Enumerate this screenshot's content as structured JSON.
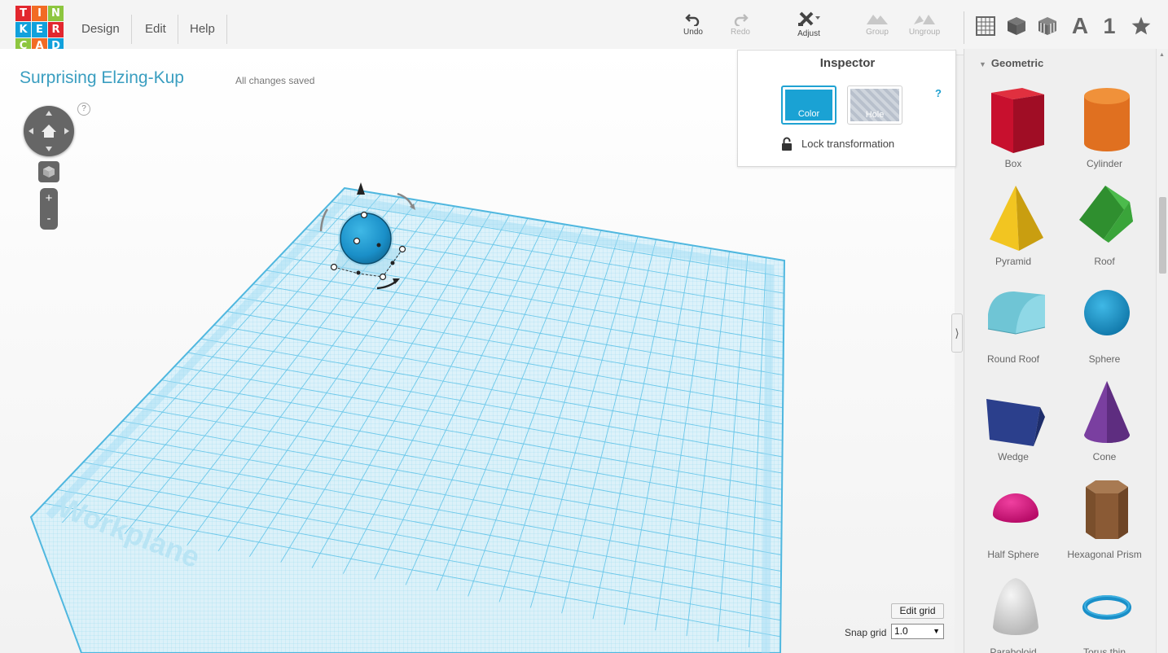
{
  "logo": {
    "letters": [
      "T",
      "I",
      "N",
      "K",
      "E",
      "R",
      "C",
      "A",
      "D"
    ],
    "colors": [
      "#e2272e",
      "#f26b24",
      "#8dc63f",
      "#11a1dc",
      "#11a1dc",
      "#e2272e",
      "#8dc63f",
      "#f26b24",
      "#11a1dc"
    ]
  },
  "menu": {
    "design": "Design",
    "edit": "Edit",
    "help": "Help"
  },
  "toolbar": {
    "undo": "Undo",
    "redo": "Redo",
    "adjust": "Adjust",
    "group": "Group",
    "ungroup": "Ungroup"
  },
  "view_icons": {
    "grid": "grid-icon",
    "cube": "cube-icon",
    "box_stripes": "striped-cube-icon",
    "text": "A",
    "number": "1",
    "star": "star-icon"
  },
  "design": {
    "title": "Surprising Elzing-Kup",
    "save_status": "All changes saved"
  },
  "help_mark": "?",
  "zoom": {
    "in": "+",
    "out": "-"
  },
  "workplane": {
    "label": "Workplane",
    "color": "#5ec5e8"
  },
  "inspector": {
    "title": "Inspector",
    "help": "?",
    "color_label": "Color",
    "hole_label": "Hole",
    "lock_label": "Lock transformation",
    "selected_color": "#1aa2d4"
  },
  "grid": {
    "edit_grid": "Edit grid",
    "snap_label": "Snap grid",
    "snap_value": "1.0"
  },
  "panel": {
    "category": "Geometric",
    "shapes": [
      {
        "label": "Box",
        "icon": "box-shape",
        "color": "#c8102e"
      },
      {
        "label": "Cylinder",
        "icon": "cylinder-shape",
        "color": "#e87722"
      },
      {
        "label": "Pyramid",
        "icon": "pyramid-shape",
        "color": "#f2c521"
      },
      {
        "label": "Roof",
        "icon": "roof-shape",
        "color": "#3aa43a"
      },
      {
        "label": "Round Roof",
        "icon": "round-roof-shape",
        "color": "#6fc5d5"
      },
      {
        "label": "Sphere",
        "icon": "sphere-shape",
        "color": "#1a8fc8"
      },
      {
        "label": "Wedge",
        "icon": "wedge-shape",
        "color": "#2b3f8c"
      },
      {
        "label": "Cone",
        "icon": "cone-shape",
        "color": "#7a3fa0"
      },
      {
        "label": "Half Sphere",
        "icon": "half-sphere-shape",
        "color": "#e0107f"
      },
      {
        "label": "Hexagonal Prism",
        "icon": "hexagonal-prism-shape",
        "color": "#8a5a35"
      },
      {
        "label": "Paraboloid",
        "icon": "paraboloid-shape",
        "color": "#d8d8d8"
      },
      {
        "label": "Torus thin",
        "icon": "torus-thin-shape",
        "color": "#1a8fc8"
      }
    ]
  }
}
